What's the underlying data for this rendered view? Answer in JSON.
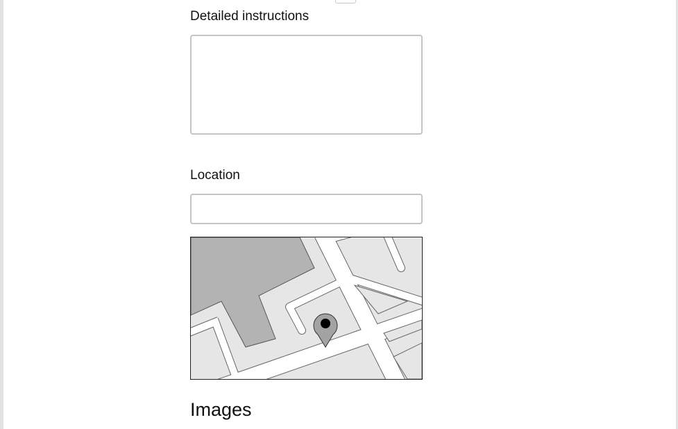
{
  "form": {
    "instructions_label": "Detailed instructions",
    "instructions_value": "",
    "location_label": "Location",
    "location_value": "",
    "map_icon": "map-pin-icon",
    "images_heading": "Images"
  },
  "colors": {
    "page_background": "#ffffff",
    "outer_background": "#e2e2e2",
    "field_border": "#c4c4c4",
    "map_block": "#e6e6e6",
    "map_building": "#b3b3b3",
    "map_road": "#ffffff",
    "pin_fill": "#a3a3a3",
    "pin_dot": "#000000"
  }
}
